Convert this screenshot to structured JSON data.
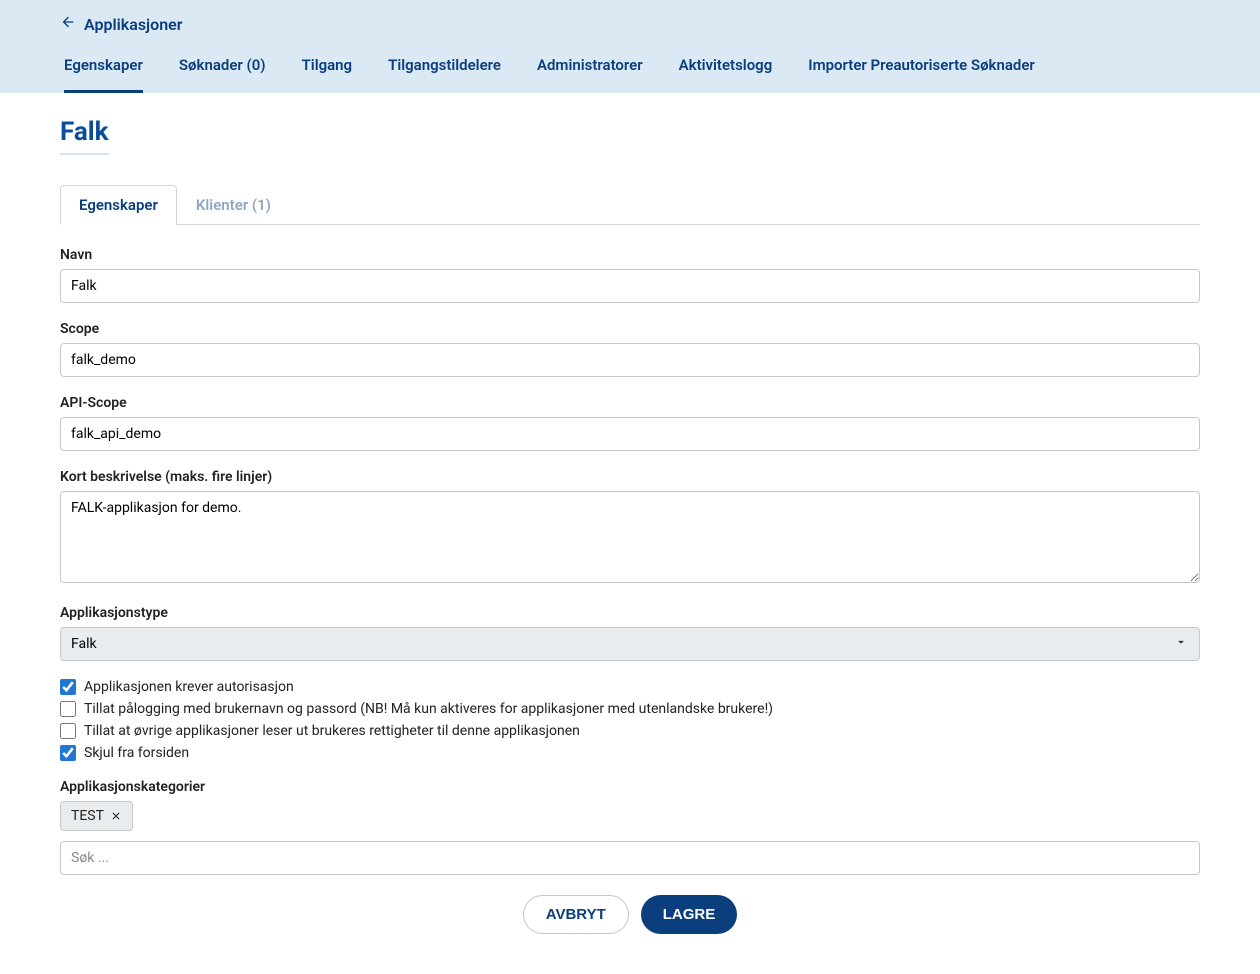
{
  "header": {
    "back_label": "Applikasjoner"
  },
  "top_tabs": [
    {
      "label": "Egenskaper",
      "active": true
    },
    {
      "label": "Søknader (0)",
      "active": false
    },
    {
      "label": "Tilgang",
      "active": false
    },
    {
      "label": "Tilgangstildelere",
      "active": false
    },
    {
      "label": "Administratorer",
      "active": false
    },
    {
      "label": "Aktivitetslogg",
      "active": false
    },
    {
      "label": "Importer Preautoriserte Søknader",
      "active": false
    }
  ],
  "page_title": "Falk",
  "sub_tabs": [
    {
      "label": "Egenskaper",
      "active": true
    },
    {
      "label": "Klienter (1)",
      "active": false
    }
  ],
  "form": {
    "navn_label": "Navn",
    "navn_value": "Falk",
    "scope_label": "Scope",
    "scope_value": "falk_demo",
    "apiscope_label": "API-Scope",
    "apiscope_value": "falk_api_demo",
    "desc_label": "Kort beskrivelse (maks. fire linjer)",
    "desc_value": "FALK-applikasjon for demo.",
    "apptype_label": "Applikasjonstype",
    "apptype_value": "Falk",
    "checkboxes": [
      {
        "label": "Applikasjonen krever autorisasjon",
        "checked": true
      },
      {
        "label": "Tillat pålogging med brukernavn og passord (NB! Må kun aktiveres for applikasjoner med utenlandske brukere!)",
        "checked": false
      },
      {
        "label": "Tillat at øvrige applikasjoner leser ut brukeres rettigheter til denne applikasjonen",
        "checked": false
      },
      {
        "label": "Skjul fra forsiden",
        "checked": true
      }
    ],
    "categories_label": "Applikasjonskategorier",
    "category_tag": "TEST",
    "search_placeholder": "Søk ..."
  },
  "buttons": {
    "cancel": "AVBRYT",
    "save": "LAGRE"
  }
}
